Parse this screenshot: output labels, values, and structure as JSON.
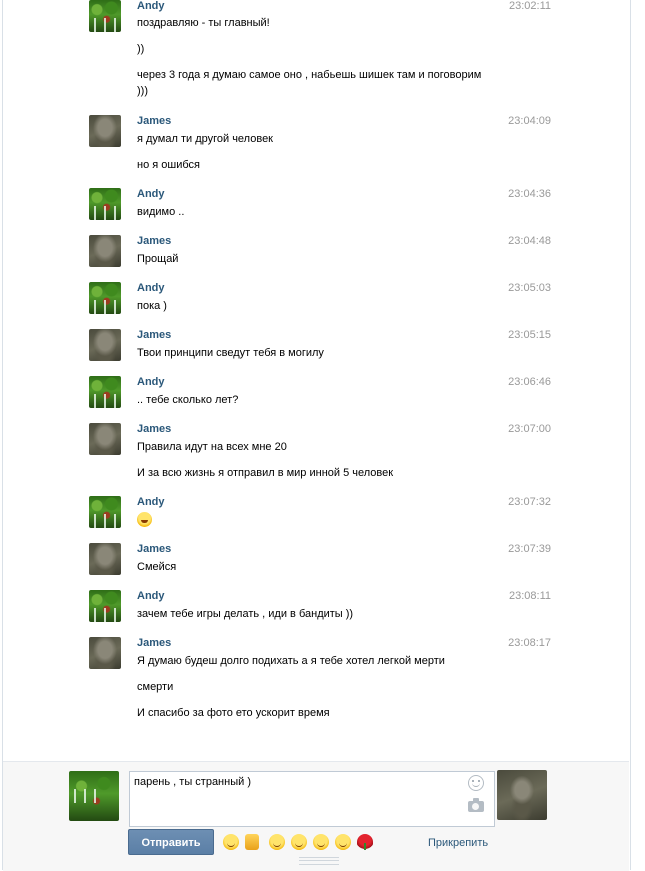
{
  "messages": [
    {
      "author": "Andy",
      "time": "23:02:11",
      "lines": [
        "поздравляю - ты главный!",
        "))",
        "через 3 года я думаю самое оно , набьешь шишек там и поговорим",
        ")))"
      ]
    },
    {
      "author": "James",
      "time": "23:04:09",
      "lines": [
        "я думал ти другой человек",
        "но я ошибся"
      ]
    },
    {
      "author": "Andy",
      "time": "23:04:36",
      "lines": [
        "видимо .."
      ]
    },
    {
      "author": "James",
      "time": "23:04:48",
      "lines": [
        "Прощай"
      ]
    },
    {
      "author": "Andy",
      "time": "23:05:03",
      "lines": [
        "пока )"
      ]
    },
    {
      "author": "James",
      "time": "23:05:15",
      "lines": [
        "Твои принципи сведут тебя в могилу"
      ]
    },
    {
      "author": "Andy",
      "time": "23:06:46",
      "lines": [
        ".. тебе сколько лет?"
      ]
    },
    {
      "author": "James",
      "time": "23:07:00",
      "lines": [
        "Правила идут на всех мне 20",
        "И за всю жизнь я отправил в мир инной 5 человек"
      ]
    },
    {
      "author": "Andy",
      "time": "23:07:32",
      "emoji": "laughing-emoji"
    },
    {
      "author": "James",
      "time": "23:07:39",
      "lines": [
        "Смейся"
      ]
    },
    {
      "author": "Andy",
      "time": "23:08:11",
      "lines": [
        "зачем тебе игры делать , иди в бандиты ))"
      ]
    },
    {
      "author": "James",
      "time": "23:08:17",
      "lines": [
        "Я думаю будеш долго подихать а я тебе хотел легкой мерти",
        "смерти",
        "И спасибо за фото ето ускорит время"
      ]
    }
  ],
  "composer": {
    "text": "парень , ты странный )",
    "send_label": "Отправить",
    "attach_label": "Прикрепить",
    "quick_smiles": [
      "laughing-emoji",
      "thumbs-up-emoji",
      "grin-emoji",
      "smile-emoji",
      "tired-emoji",
      "unamused-emoji",
      "rose-emoji"
    ]
  },
  "colors": {
    "author": "#2b587a",
    "time": "#999999",
    "button": "#5b7fa6"
  }
}
